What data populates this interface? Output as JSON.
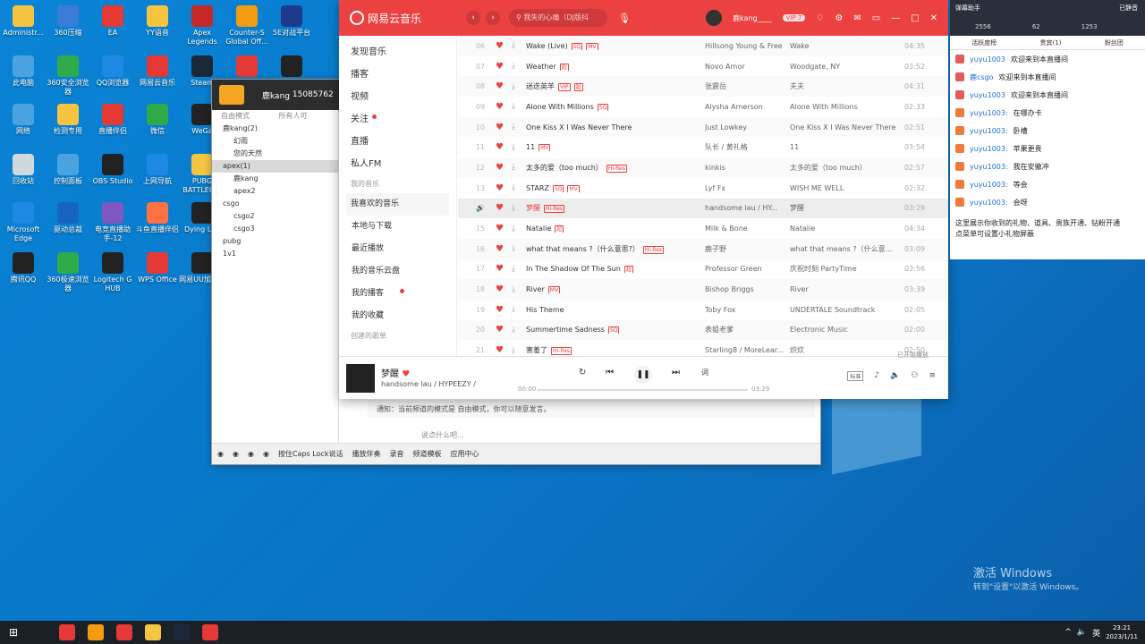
{
  "desktop": {
    "icons": [
      {
        "label": "Administr...",
        "color": "#f5c542"
      },
      {
        "label": "360压缩",
        "color": "#3a7bd5"
      },
      {
        "label": "EA",
        "color": "#e53935"
      },
      {
        "label": "YY语音",
        "color": "#f5c542"
      },
      {
        "label": "Apex Legends",
        "color": "#c62828"
      },
      {
        "label": "Counter-S Global Off...",
        "color": "#f39c12"
      },
      {
        "label": "5E对战平台",
        "color": "#1e3a8a"
      },
      {
        "label": "此电脑",
        "color": "#4aa3df"
      },
      {
        "label": "360安全浏览器",
        "color": "#2eaa4a"
      },
      {
        "label": "QQ浏览器",
        "color": "#1e88e5"
      },
      {
        "label": "网易云音乐",
        "color": "#e53935"
      },
      {
        "label": "Steam",
        "color": "#1b2838"
      },
      {
        "label": "",
        "color": "#e53935"
      },
      {
        "label": "",
        "color": "#222"
      },
      {
        "label": "网络",
        "color": "#4aa3df"
      },
      {
        "label": "检测专用",
        "color": "#f5c542"
      },
      {
        "label": "直播伴侣",
        "color": "#e53935"
      },
      {
        "label": "微信",
        "color": "#2eaa4a"
      },
      {
        "label": "WeGa",
        "color": "#222"
      },
      {
        "label": "回收站",
        "color": "#cfd8dc"
      },
      {
        "label": "控制面板",
        "color": "#4aa3df"
      },
      {
        "label": "OBS Studio",
        "color": "#222"
      },
      {
        "label": "上网导航",
        "color": "#1e88e5"
      },
      {
        "label": "PUBG BATTLEG...",
        "color": "#f5c542"
      },
      {
        "label": "Microsoft Edge",
        "color": "#1e88e5"
      },
      {
        "label": "驱动总裁",
        "color": "#1565c0"
      },
      {
        "label": "电竞直播助手-12",
        "color": "#7e57c2"
      },
      {
        "label": "斗鱼直播伴侣",
        "color": "#ff7043"
      },
      {
        "label": "Dying Li...",
        "color": "#222"
      },
      {
        "label": "腾讯QQ",
        "color": "#222"
      },
      {
        "label": "360极速浏览器",
        "color": "#2eaa4a"
      },
      {
        "label": "Logitech G HUB",
        "color": "#222"
      },
      {
        "label": "WPS Office",
        "color": "#e53935"
      },
      {
        "label": "网易UU加速器",
        "color": "#222"
      }
    ]
  },
  "yy": {
    "user": "鹿kang",
    "id": "15085762",
    "mode": "自由模式",
    "channel_label": "所有人可",
    "left": [
      "鹿kang(2)",
      "幻雨",
      "您的天然",
      "apex(1)",
      "鹿kang",
      "apex2",
      "csgo",
      "csgo2",
      "csgo3",
      "pubg",
      "1v1"
    ],
    "notice": "通知：当前频道的模式是 自由模式，你可以随意发言。",
    "input_placeholder": "说点什么吧...",
    "bottom": [
      "按住Caps Lock说话",
      "播放伴奏",
      "录音",
      "频道模板",
      "应用中心"
    ]
  },
  "netease": {
    "app_name": "网易云音乐",
    "search_placeholder": "我失的心痛（DJ版抖",
    "user": "鹿kang____",
    "vip": "VIP 7",
    "sidebar": {
      "items": [
        "发现音乐",
        "播客",
        "视频",
        "关注",
        "直播",
        "私人FM"
      ],
      "section_my": "我的音乐",
      "my_items": [
        "我喜欢的音乐",
        "本地与下载",
        "最近播放",
        "我的音乐云盘",
        "我的播客",
        "我的收藏"
      ],
      "section_created": "创建的歌单"
    },
    "tracks": [
      {
        "no": "06",
        "title": "Wake (Live)",
        "tags": [
          "SQ",
          "MV"
        ],
        "artist": "Hillsong Young & Free",
        "album": "Wake",
        "dur": "04:35"
      },
      {
        "no": "07",
        "title": "Weather",
        "tags": [
          "超"
        ],
        "artist": "Novo Amor",
        "album": "Woodgate, NY",
        "dur": "03:52"
      },
      {
        "no": "08",
        "title": "迷迭英羊",
        "tags": [
          "VIP",
          "超"
        ],
        "artist": "张震岳",
        "album": "夫夫",
        "dur": "04:31"
      },
      {
        "no": "09",
        "title": "Alone With Millions",
        "tags": [
          "SQ"
        ],
        "artist": "Alysha Amerson",
        "album": "Alone With Millions",
        "dur": "02:33"
      },
      {
        "no": "10",
        "title": "One Kiss X I Was Never There",
        "tags": [],
        "artist": "Just Lowkey",
        "album": "One Kiss X I Was Never There",
        "dur": "02:51"
      },
      {
        "no": "11",
        "title": "11",
        "tags": [
          "MV"
        ],
        "artist": "队长 / 黄礼格",
        "album": "11",
        "dur": "03:54"
      },
      {
        "no": "12",
        "title": "太多的爱（too much）",
        "tags": [
          "Hi-Res"
        ],
        "artist": "kinkis",
        "album": "太多的爱（too much）",
        "dur": "02:57"
      },
      {
        "no": "13",
        "title": "STARZ",
        "tags": [
          "SQ",
          "MV"
        ],
        "artist": "Lyf Fx",
        "album": "WISH ME WELL",
        "dur": "02:32"
      },
      {
        "no": "14",
        "title": "梦醒",
        "tags": [
          "Hi-Res"
        ],
        "artist": "handsome lau / HY...",
        "album": "梦醒",
        "dur": "03:29",
        "playing": true
      },
      {
        "no": "15",
        "title": "Natalie",
        "tags": [
          "超"
        ],
        "artist": "Milk & Bone",
        "album": "Natalie",
        "dur": "04:34"
      },
      {
        "no": "16",
        "title": "what that means ?（什么意思?）",
        "tags": [
          "Hi-Res"
        ],
        "artist": "鹿子野",
        "album": "what that means ?（什么意...",
        "dur": "03:09"
      },
      {
        "no": "17",
        "title": "In The Shadow Of The Sun",
        "tags": [
          "超"
        ],
        "artist": "Professor Green",
        "album": "庆祝时刻 PartyTime",
        "dur": "03:56"
      },
      {
        "no": "18",
        "title": "River",
        "tags": [
          "MV"
        ],
        "artist": "Bishop Briggs",
        "album": "River",
        "dur": "03:39"
      },
      {
        "no": "19",
        "title": "His Theme",
        "tags": [],
        "artist": "Toby Fox",
        "album": "UNDERTALE Soundtrack",
        "dur": "02:05"
      },
      {
        "no": "20",
        "title": "Summertime Sadness",
        "tags": [
          "SQ"
        ],
        "artist": "表姐老爹",
        "album": "Electronic Music",
        "dur": "02:00"
      },
      {
        "no": "21",
        "title": "害羞了",
        "tags": [
          "Hi-Res"
        ],
        "artist": "Starling8 / MoreLear...",
        "album": "炽炊",
        "dur": "02:50"
      }
    ],
    "player": {
      "title": "梦醒",
      "artist": "handsome lau / HYPEEZY /",
      "time_cur": "00:00",
      "time_total": "03:29",
      "lyric_btn": "词",
      "quality": "标准",
      "progress": 0,
      "start_tip": "已开始播放"
    }
  },
  "live": {
    "title": "弹幕助手",
    "status": "已静音",
    "stats": [
      "2556",
      "62",
      "1253"
    ],
    "tabs": [
      "活跃度榜",
      "贵宾(1)",
      "粉丝团"
    ],
    "messages": [
      {
        "u": "yuyu1003",
        "t": "欢迎来到本直播间",
        "b": "r"
      },
      {
        "u": "鹿csgo",
        "t": "欢迎来到本直播间",
        "b": "r"
      },
      {
        "u": "yuyu1003",
        "t": "欢迎来到本直播间",
        "b": "r"
      },
      {
        "u": "yuyu1003:",
        "t": "在哪办卡",
        "b": "o"
      },
      {
        "u": "yuyu1003:",
        "t": "卧槽",
        "b": "o"
      },
      {
        "u": "yuyu1003:",
        "t": "苹果更贵",
        "b": "o"
      },
      {
        "u": "yuyu1003:",
        "t": "我在安徽冲",
        "b": "o"
      },
      {
        "u": "yuyu1003:",
        "t": "等会",
        "b": "o"
      },
      {
        "u": "yuyu1003:",
        "t": "会呀",
        "b": "o"
      }
    ],
    "info1": "这里展示你收到的礼物、道具、贵族开通、钻粉开通",
    "info2": "点菜单可设置小礼物屏蔽"
  },
  "watermark": {
    "line1": "激活 Windows",
    "line2": "转到\"设置\"以激活 Windows。"
  },
  "taskbar": {
    "time": "23:21",
    "date": "2023/1/11",
    "ime": "英",
    "apps": [
      "#1b1f26",
      "#e53935",
      "#f39c12",
      "#e53935",
      "#f5c542",
      "#1b2838",
      "#e53935"
    ]
  }
}
